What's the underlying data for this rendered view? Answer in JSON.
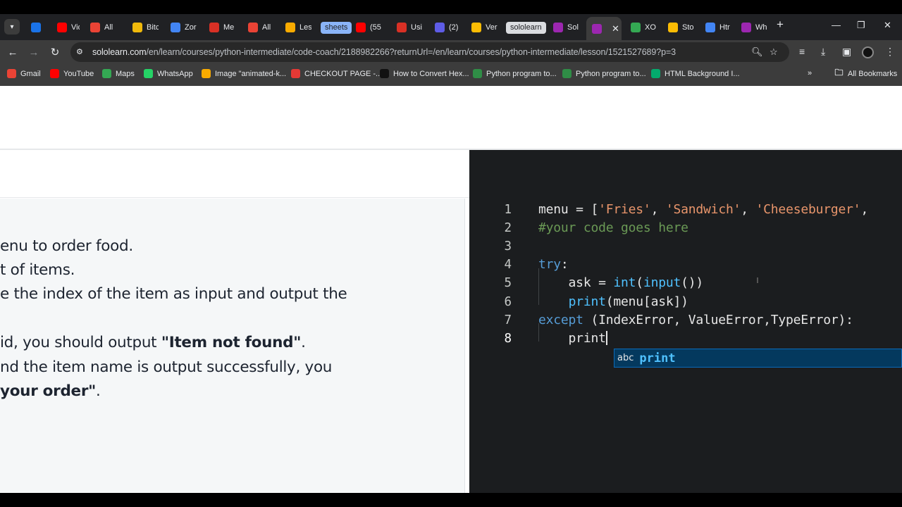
{
  "browser": {
    "tabs": [
      {
        "label": "",
        "icon": "m-logo-icon",
        "color": "#1a73e8"
      },
      {
        "label": "Vid",
        "icon": "youtube-icon",
        "color": "#ff0000"
      },
      {
        "label": "All",
        "icon": "gmail-icon",
        "color": "#ea4335"
      },
      {
        "label": "Bitc",
        "icon": "binance-icon",
        "color": "#f0b90b"
      },
      {
        "label": "Zor",
        "icon": "docs-icon",
        "color": "#4285f4"
      },
      {
        "label": "Me",
        "icon": "meet-icon",
        "color": "#d93025"
      },
      {
        "label": "All",
        "icon": "gmail-icon",
        "color": "#ea4335"
      },
      {
        "label": "Les",
        "icon": "lesson-icon",
        "color": "#f9ab00"
      },
      {
        "label": "(55",
        "icon": "youtube-icon",
        "color": "#ff0000"
      },
      {
        "label": "Usi",
        "icon": "record-icon",
        "color": "#d93025"
      },
      {
        "label": "(2)",
        "icon": "chat-icon",
        "color": "#5e5ce6"
      },
      {
        "label": "Ver",
        "icon": "drive-icon",
        "color": "#fbbc04"
      },
      {
        "label": "Sol",
        "icon": "sololearn-icon",
        "color": "#9c27b0"
      },
      {
        "label": "",
        "icon": "sololearn-icon",
        "color": "#9c27b0",
        "active": true
      },
      {
        "label": "XO",
        "icon": "xo-icon",
        "color": "#34a853"
      },
      {
        "label": "Sto",
        "icon": "drive-icon",
        "color": "#fbbc04"
      },
      {
        "label": "Htr",
        "icon": "html-icon",
        "color": "#4285f4"
      },
      {
        "label": "Wh",
        "icon": "sololearn-icon",
        "color": "#9c27b0"
      }
    ],
    "tab_groups": [
      {
        "label": "sheets",
        "color": "#8ab4f8"
      },
      {
        "label": "sololearn",
        "color": "#dadce0"
      }
    ],
    "url_host": "sololearn.com",
    "url_path": "/en/learn/courses/python-intermediate/code-coach/2188982266?returnUrl=/en/learn/courses/python-intermediate/lesson/1521527689?p=3",
    "bookmarks": [
      {
        "label": "Gmail",
        "icon": "gmail-icon",
        "color": "#ea4335"
      },
      {
        "label": "YouTube",
        "icon": "youtube-icon",
        "color": "#ff0000"
      },
      {
        "label": "Maps",
        "icon": "maps-icon",
        "color": "#34a853"
      },
      {
        "label": "WhatsApp",
        "icon": "whatsapp-icon",
        "color": "#25d366"
      },
      {
        "label": "Image \"animated-k...",
        "icon": "star-icon",
        "color": "#f9ab00"
      },
      {
        "label": "CHECKOUT PAGE -...",
        "icon": "checkout-icon",
        "color": "#e53935"
      },
      {
        "label": "How to Convert Hex...",
        "icon": "alpha-icon",
        "color": "#111111"
      },
      {
        "label": "Python program to...",
        "icon": "gfg-icon",
        "color": "#2f8d46"
      },
      {
        "label": "Python program to...",
        "icon": "gfg-icon",
        "color": "#2f8d46"
      },
      {
        "label": "HTML Background I...",
        "icon": "w3-icon",
        "color": "#04aa6d"
      }
    ],
    "all_bookmarks_label": "All Bookmarks"
  },
  "description": {
    "lines": [
      {
        "pre": "enu to order food.",
        "bold": "",
        "post": ""
      },
      {
        "pre": "t of items.",
        "bold": "",
        "post": ""
      },
      {
        "pre": "e the index of the item as input and output the",
        "bold": "",
        "post": ""
      },
      {
        "pre": "id, you should output ",
        "bold": "\"Item not found\"",
        "post": "."
      },
      {
        "pre": "nd the item name is output successfully, you",
        "bold": "",
        "post": ""
      },
      {
        "pre": "",
        "bold": " your order\"",
        "post": "."
      }
    ]
  },
  "editor": {
    "line_numbers": [
      "1",
      "2",
      "3",
      "4",
      "5",
      "6",
      "7",
      "8"
    ],
    "lines": [
      [
        {
          "t": "menu = [",
          "c": ""
        },
        {
          "t": "'Fries'",
          "c": "str"
        },
        {
          "t": ", ",
          "c": ""
        },
        {
          "t": "'Sandwich'",
          "c": "str"
        },
        {
          "t": ", ",
          "c": ""
        },
        {
          "t": "'Cheeseburger'",
          "c": "str"
        },
        {
          "t": ",",
          "c": ""
        }
      ],
      [
        {
          "t": "#your code goes here",
          "c": "cmt"
        }
      ],
      [],
      [
        {
          "t": "try",
          "c": "kw"
        },
        {
          "t": ":",
          "c": ""
        }
      ],
      [
        {
          "t": "    ask = ",
          "c": ""
        },
        {
          "t": "int",
          "c": "fn"
        },
        {
          "t": "(",
          "c": ""
        },
        {
          "t": "input",
          "c": "fn"
        },
        {
          "t": "())",
          "c": ""
        }
      ],
      [
        {
          "t": "    ",
          "c": ""
        },
        {
          "t": "print",
          "c": "fn"
        },
        {
          "t": "(menu[ask])",
          "c": ""
        }
      ],
      [
        {
          "t": "except",
          "c": "kw"
        },
        {
          "t": " (IndexError, ValueError,TypeError):",
          "c": ""
        }
      ],
      [
        {
          "t": "    print",
          "c": ""
        }
      ]
    ],
    "suggestion": {
      "kind": "abc",
      "word": "print"
    }
  }
}
